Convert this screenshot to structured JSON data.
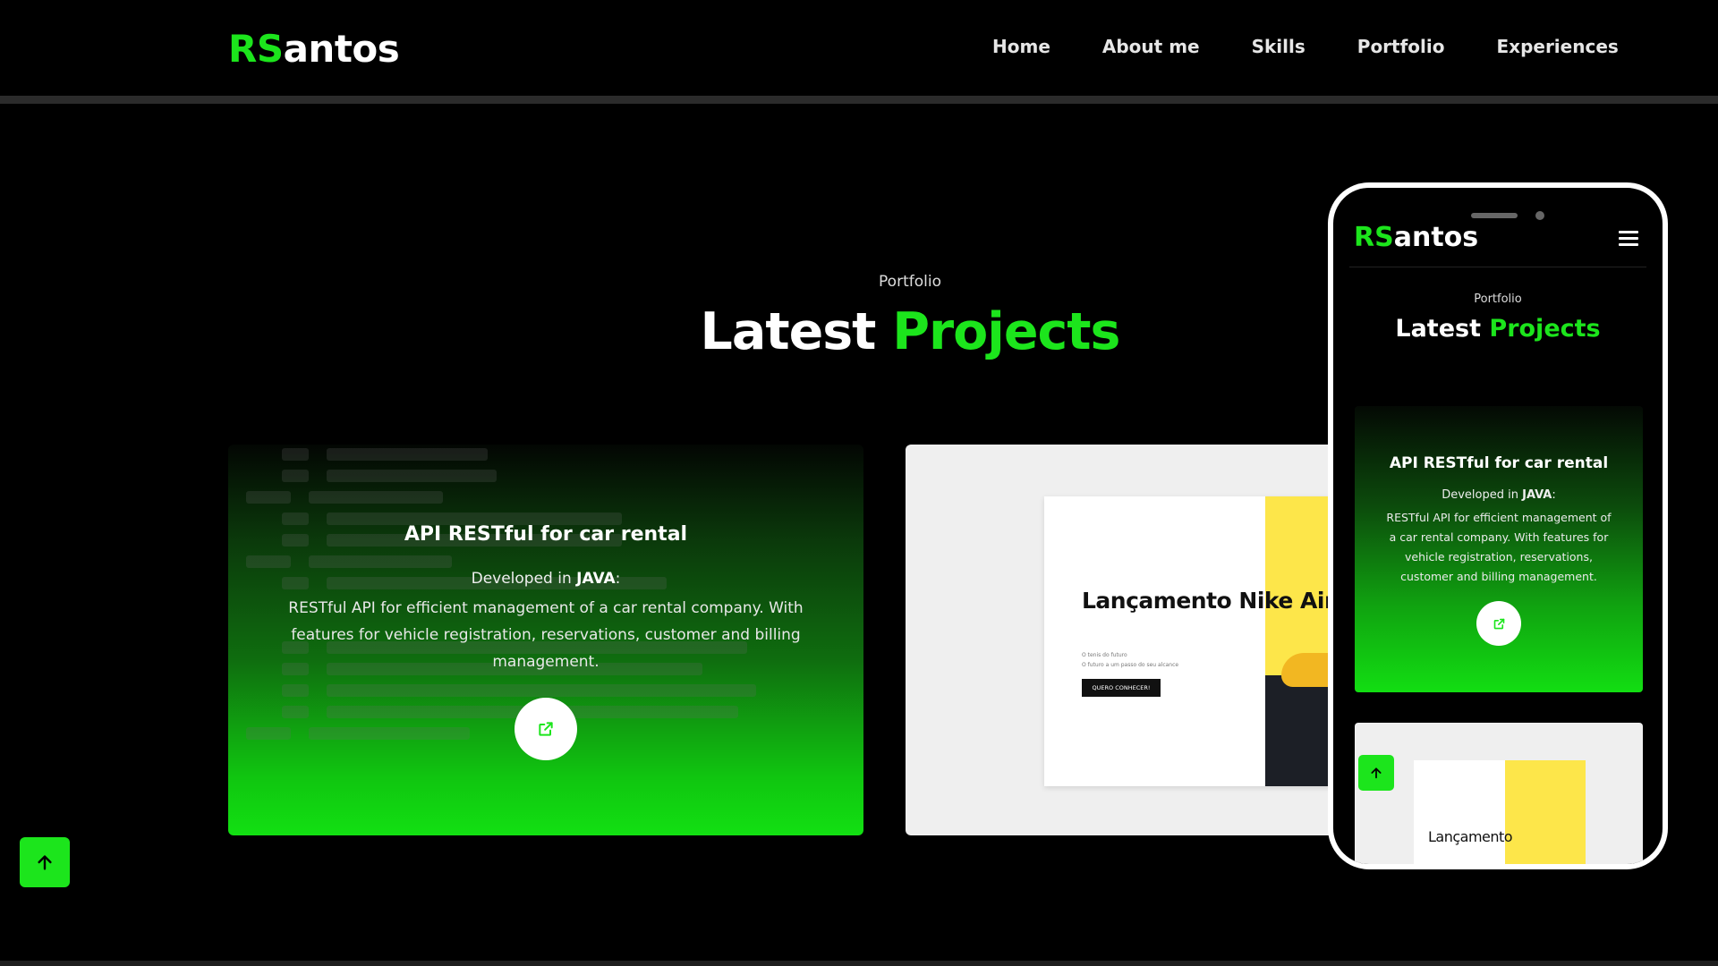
{
  "header": {
    "logo_accent": "RS",
    "logo_rest": "antos",
    "nav": [
      "Home",
      "About me",
      "Skills",
      "Portfolio",
      "Experiences"
    ]
  },
  "section": {
    "eyebrow": "Portfolio",
    "title_white": "Latest ",
    "title_green": "Projects"
  },
  "projects": [
    {
      "title": "API RESTful for car rental",
      "developed_prefix": "Developed in ",
      "developed_lang": "JAVA",
      "developed_suffix": ":",
      "description": "RESTful API for efficient management of a car rental company. With features for vehicle registration, reservations, customer and billing management.",
      "link_icon": "external-link-icon"
    },
    {
      "preview_title": "Lançamento Nike Air.",
      "preview_sub1": "O tenis do futuro",
      "preview_sub2": "O futuro a um passo do seu alcance",
      "preview_button": "QUERO CONHECER!"
    }
  ],
  "phone": {
    "logo_accent": "RS",
    "logo_rest": "antos",
    "menu_icon": "hamburger-icon",
    "eyebrow": "Portfolio",
    "title_white": "Latest ",
    "title_green": "Projects",
    "card_title": "API RESTful for car rental",
    "card_dev_prefix": "Developed in ",
    "card_dev_lang": "JAVA",
    "card_dev_suffix": ":",
    "card_desc": "RESTful API for efficient management of a car rental company. With features for vehicle registration, reservations, customer and billing management.",
    "card2_text": "Lançamento"
  },
  "scroll_up_icon": "arrow-up-icon",
  "colors": {
    "accent": "#1ce51c",
    "background": "#000000",
    "card_light": "#efefef"
  }
}
